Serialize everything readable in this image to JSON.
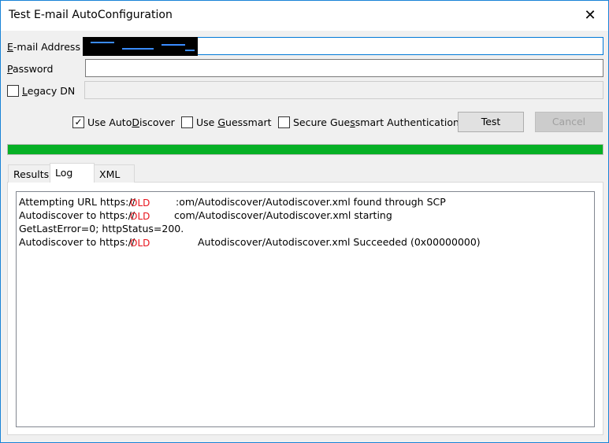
{
  "window": {
    "title": "Test E-mail AutoConfiguration",
    "close_icon": "close-icon"
  },
  "fields": {
    "email": {
      "label_key": "E",
      "label_rest": "-mail Address",
      "value": ""
    },
    "password": {
      "label_key": "P",
      "label_rest": "assword",
      "value": ""
    },
    "legacy_dn": {
      "label_key": "L",
      "label_rest": "egacy DN",
      "checked": false,
      "value": ""
    }
  },
  "options": [
    {
      "pre": "Use Auto",
      "key": "D",
      "post": "iscover",
      "checked": true
    },
    {
      "pre": "Use ",
      "key": "G",
      "post": "uessmart",
      "checked": false
    },
    {
      "pre": "Secure Gue",
      "key": "s",
      "post": "smart Authentication",
      "checked": false
    }
  ],
  "buttons": {
    "test": "Test",
    "cancel": "Cancel"
  },
  "progress": {
    "percent": 100,
    "color": "#06b025"
  },
  "tabs": [
    {
      "label": "Results"
    },
    {
      "label": "Log",
      "selected": true
    },
    {
      "label": "XML"
    }
  ],
  "log": [
    {
      "before": "Attempting URL https://",
      "overlay": "OLD",
      "after": ":om/Autodiscover/Autodiscover.xml found through SCP"
    },
    {
      "before": "Autodiscover to https://",
      "overlay": "OLD",
      "after": "com/Autodiscover/Autodiscover.xml starting"
    },
    {
      "before": "GetLastError=0; httpStatus=200.",
      "overlay": "",
      "after": ""
    },
    {
      "before": "Autodiscover to https://",
      "overlay": "OLD",
      "after": "Autodiscover/Autodiscover.xml Succeeded (0x00000000)"
    }
  ]
}
